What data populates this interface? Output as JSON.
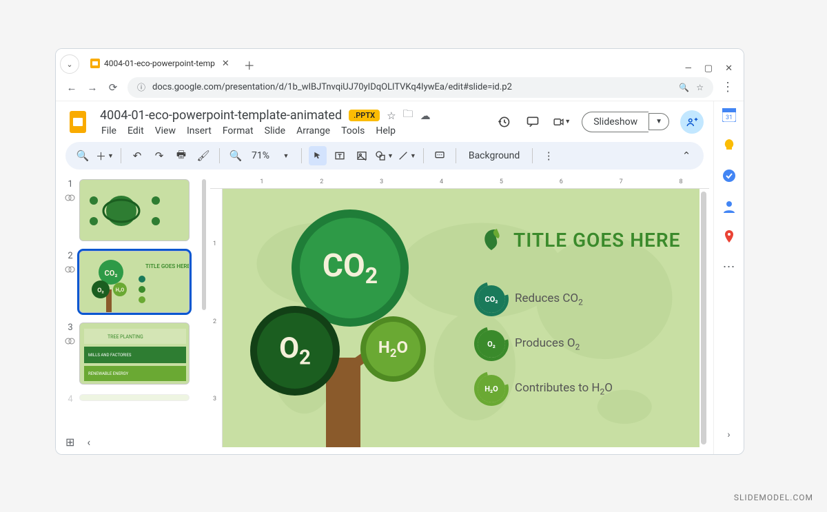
{
  "browser": {
    "tab_title": "4004-01-eco-powerpoint-temp",
    "url": "docs.google.com/presentation/d/1b_wIBJTnvqiUJ70yIDqOLlTVKq4IywEa/edit#slide=id.p2"
  },
  "app": {
    "doc_title": "4004-01-eco-powerpoint-template-animated",
    "badge": ".PPTX",
    "menus": [
      "File",
      "Edit",
      "View",
      "Insert",
      "Format",
      "Slide",
      "Arrange",
      "Tools",
      "Help"
    ],
    "slideshow_label": "Slideshow",
    "zoom": "71%",
    "background_label": "Background"
  },
  "filmstrip": {
    "slides": [
      1,
      2,
      3,
      4
    ],
    "active": 2
  },
  "ruler_h": [
    "",
    "1",
    "",
    "2",
    "",
    "3",
    "",
    "4",
    "",
    "5",
    "",
    "6",
    "",
    "7",
    "",
    "8"
  ],
  "ruler_v": [
    "",
    "1",
    "",
    "2",
    "",
    "3"
  ],
  "slide": {
    "title": "TITLE GOES HERE",
    "bubbles": {
      "co2": "CO",
      "o2": "O",
      "h2o": "H"
    },
    "items": [
      {
        "chip": "CO₂",
        "text_a": "Reduces CO",
        "sub": "2"
      },
      {
        "chip": "O₂",
        "text_a": "Produces O",
        "sub": "2"
      },
      {
        "chip": "H₂O",
        "text_a": "Contributes to H",
        "sub": "2",
        "text_b": "O"
      }
    ]
  },
  "watermark": "SLIDEMODEL.COM"
}
